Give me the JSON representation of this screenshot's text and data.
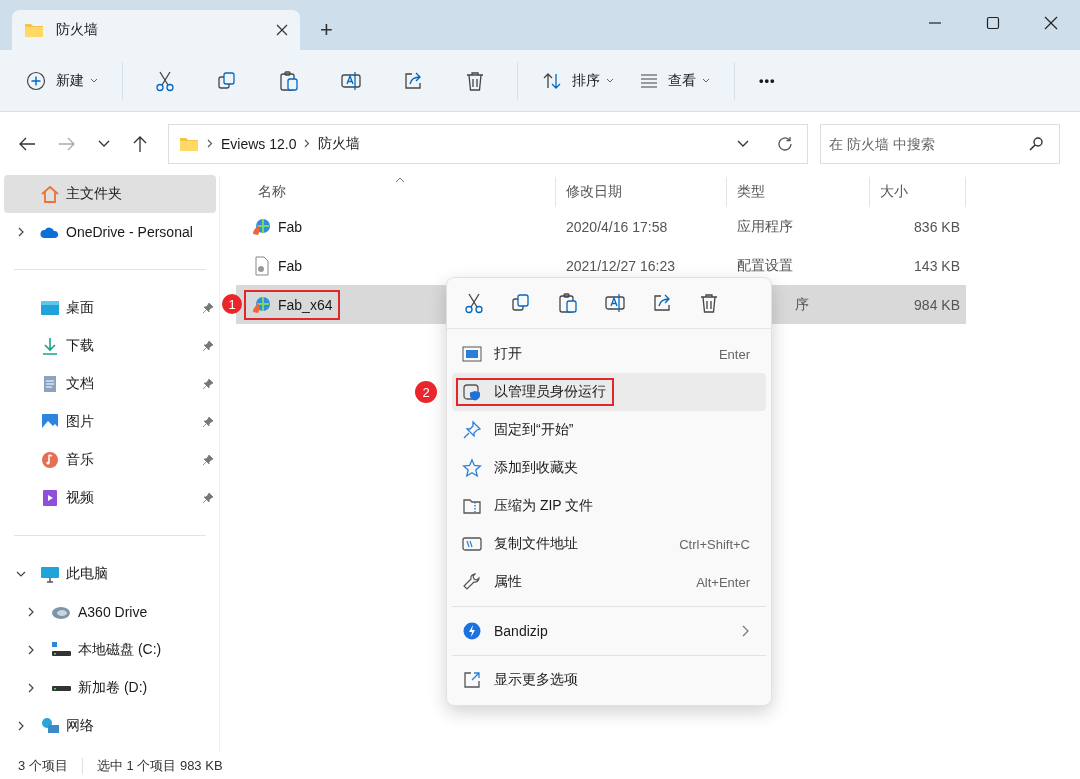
{
  "tab": {
    "title": "防火墙",
    "new_tab": "+"
  },
  "toolbar": {
    "new": "新建",
    "sort": "排序",
    "view": "查看",
    "more": "•••"
  },
  "address": {
    "crumbs": [
      "Eviews 12.0",
      "防火墙"
    ],
    "search_placeholder": "在 防火墙 中搜索"
  },
  "sidebar": {
    "items": [
      {
        "kind": "home",
        "label": "主文件夹",
        "selected": true
      },
      {
        "kind": "cloud",
        "label": "OneDrive - Personal",
        "selected": false,
        "expanded": false
      },
      {
        "kind": "divider"
      },
      {
        "kind": "desktop",
        "label": "桌面",
        "selected": false,
        "pinned": true
      },
      {
        "kind": "download",
        "label": "下载",
        "selected": false,
        "pinned": true
      },
      {
        "kind": "document",
        "label": "文档",
        "selected": false,
        "pinned": true
      },
      {
        "kind": "pictures",
        "label": "图片",
        "selected": false,
        "pinned": true
      },
      {
        "kind": "music",
        "label": "音乐",
        "selected": false,
        "pinned": true
      },
      {
        "kind": "video",
        "label": "视频",
        "selected": false,
        "pinned": true
      },
      {
        "kind": "divider"
      },
      {
        "kind": "pc",
        "label": "此电脑",
        "selected": false,
        "expanded": true,
        "children": [
          {
            "kind": "a360",
            "label": "A360 Drive",
            "selected": false,
            "expanded": false
          },
          {
            "kind": "drive_c",
            "label": "本地磁盘 (C:)",
            "selected": false,
            "expanded": false
          },
          {
            "kind": "drive",
            "label": "新加卷 (D:)",
            "selected": false,
            "expanded": false
          }
        ]
      },
      {
        "kind": "network",
        "label": "网络",
        "selected": false,
        "expanded": false
      }
    ]
  },
  "table": {
    "columns": [
      "名称",
      "修改日期",
      "类型",
      "大小"
    ],
    "rows": [
      {
        "kind": "app",
        "name": "Fab",
        "date": "2020/4/16 17:58",
        "type": "应用程序",
        "size": "836 KB",
        "selected": false
      },
      {
        "kind": "config",
        "name": "Fab",
        "date": "2021/12/27 16:23",
        "type": "配置设置",
        "size": "143 KB",
        "selected": false
      },
      {
        "kind": "app",
        "name": "Fab_x64",
        "type": "序",
        "size": "984 KB",
        "selected": true,
        "marker": "1"
      }
    ]
  },
  "context_menu": {
    "items": [
      {
        "kind": "open",
        "label": "打开",
        "shortcut": "Enter",
        "selected": false
      },
      {
        "kind": "admin",
        "label": "以管理员身份运行",
        "selected": true,
        "marker": "2"
      },
      {
        "kind": "pin",
        "label": "固定到“开始”",
        "selected": false
      },
      {
        "kind": "star",
        "label": "添加到收藏夹",
        "selected": false
      },
      {
        "kind": "zip",
        "label": "压缩为 ZIP 文件",
        "selected": false
      },
      {
        "kind": "path",
        "label": "复制文件地址",
        "shortcut": "Ctrl+Shift+C",
        "selected": false
      },
      {
        "kind": "props",
        "label": "属性",
        "shortcut": "Alt+Enter",
        "selected": false
      },
      {
        "kind": "divider"
      },
      {
        "kind": "bandizip",
        "label": "Bandizip",
        "submenu": true,
        "selected": false
      },
      {
        "kind": "divider"
      },
      {
        "kind": "more",
        "label": "显示更多选项",
        "selected": false
      }
    ]
  },
  "status_bar": {
    "count": "3 个项目",
    "selection": "选中 1 个项目  983 KB"
  }
}
